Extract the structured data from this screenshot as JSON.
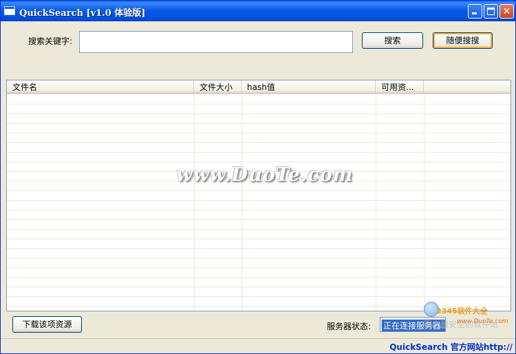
{
  "window": {
    "title": "QuickSearch [v1.0 体验版]"
  },
  "search": {
    "label": "搜索关键字:",
    "value": "",
    "placeholder": "",
    "search_button": "搜索",
    "random_button": "随便搜搜"
  },
  "table": {
    "columns": [
      "文件名",
      "文件大小",
      "hash值",
      "可用资..."
    ],
    "rows": []
  },
  "watermark": "www.DuoTe.com",
  "bottom": {
    "download_button": "下载该项资源",
    "status_label": "服务器状态:",
    "status_value": "正在连接服务器..."
  },
  "badge": {
    "brand": "2345软件大全",
    "url": "www.DuoTe.com",
    "slogan": "国内最安全的软件站"
  },
  "statusbar": {
    "link": "QuickSearch 官方网站http://"
  },
  "colors": {
    "titlebar": "#0054e3",
    "selection": "#316ac5",
    "link": "#0033cc"
  }
}
